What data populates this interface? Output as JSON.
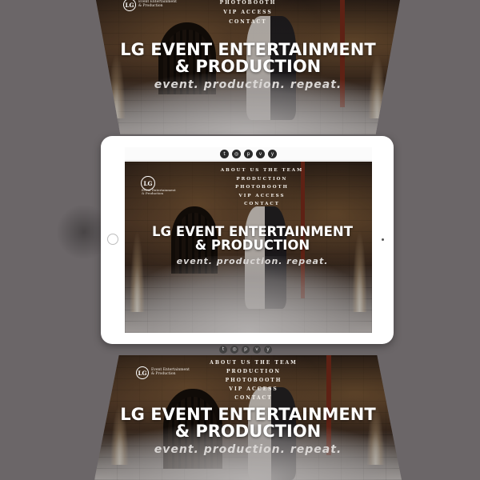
{
  "site": {
    "logo_mark": "LG",
    "logo_line1": "Event Entertainment",
    "logo_line2": "& Production",
    "nav": [
      "ABOUT US THE TEAM",
      "PRODUCTION",
      "PHOTOBOOTH",
      "VIP ACCESS",
      "CONTACT"
    ],
    "headline_line1": "LG EVENT ENTERTAINMENT",
    "headline_line2": "& PRODUCTION",
    "tagline": "event. production. repeat."
  },
  "social_icons": [
    "twitter-icon",
    "instagram-icon",
    "pinterest-icon",
    "vimeo-icon",
    "yelp-icon"
  ],
  "social_glyphs": [
    "t",
    "◎",
    "p",
    "v",
    "y"
  ],
  "colors": {
    "background": "#6b6668",
    "tablet": "#ffffff",
    "headline": "#ffffff",
    "accent_pillar": "#7a2a1a"
  }
}
